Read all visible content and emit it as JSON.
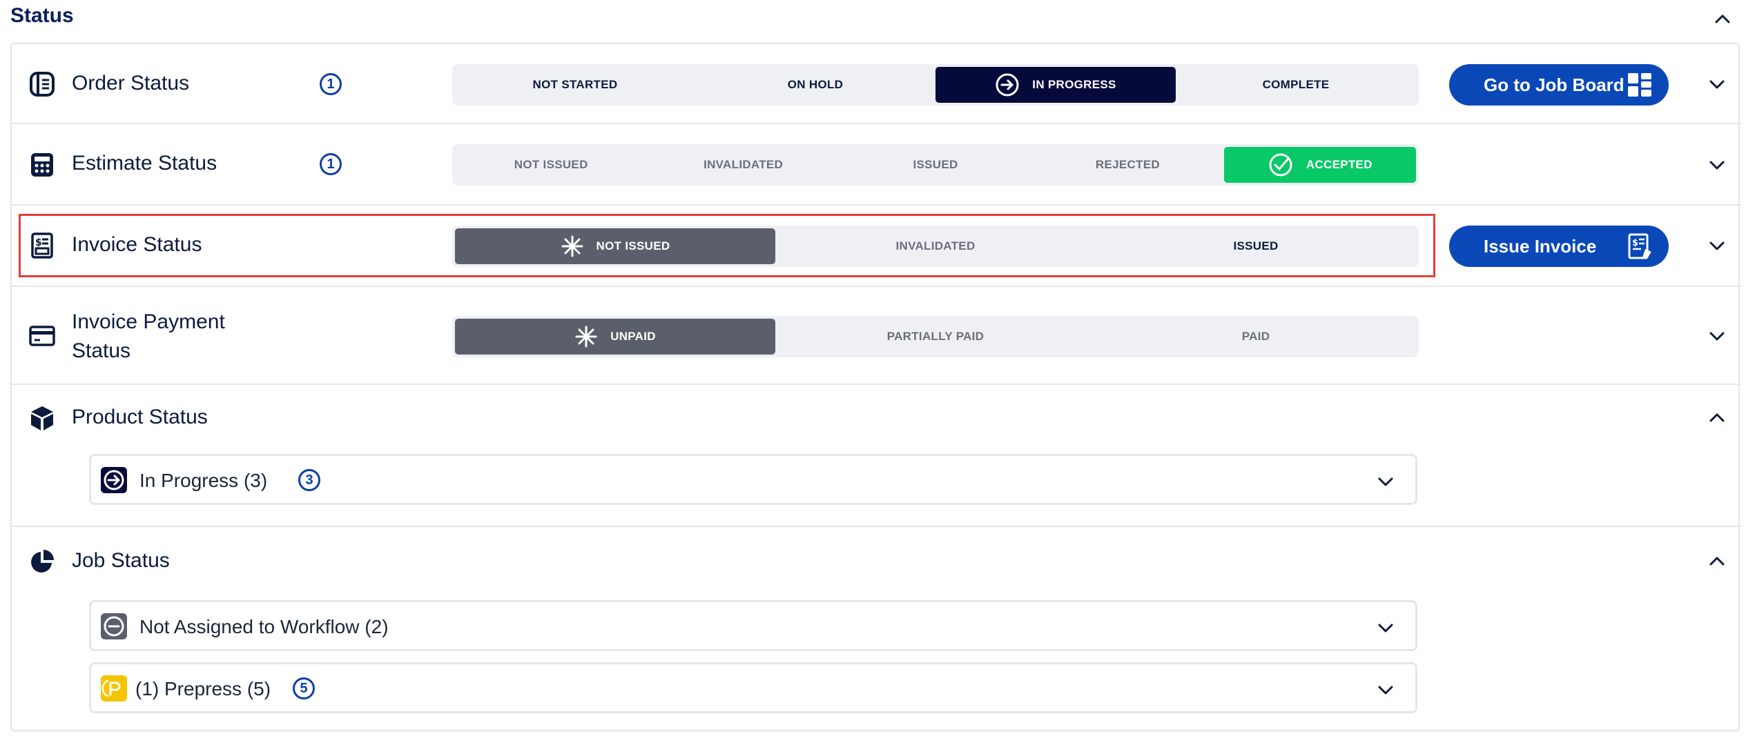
{
  "section": {
    "title": "Status"
  },
  "order_status": {
    "label": "Order Status",
    "badge": "1",
    "options": [
      "NOT STARTED",
      "ON HOLD",
      "IN PROGRESS",
      "COMPLETE"
    ],
    "selected": "IN PROGRESS",
    "action_label": "Go to Job Board"
  },
  "estimate_status": {
    "label": "Estimate Status",
    "badge": "1",
    "options": [
      "NOT ISSUED",
      "INVALIDATED",
      "ISSUED",
      "REJECTED",
      "ACCEPTED"
    ],
    "selected": "ACCEPTED"
  },
  "invoice_status": {
    "label": "Invoice Status",
    "options": [
      "NOT ISSUED",
      "INVALIDATED",
      "ISSUED"
    ],
    "selected": "NOT ISSUED",
    "action_label": "Issue Invoice"
  },
  "invoice_payment_status": {
    "label_line1": "Invoice Payment",
    "label_line2": "Status",
    "options": [
      "UNPAID",
      "PARTIALLY PAID",
      "PAID"
    ],
    "selected": "UNPAID"
  },
  "product_status": {
    "label": "Product Status",
    "items": [
      {
        "label": "In Progress (3)",
        "badge": "3",
        "icon": "arrow-right-circle-icon"
      }
    ]
  },
  "job_status": {
    "label": "Job Status",
    "items": [
      {
        "label": "Not Assigned to Workflow (2)",
        "icon": "minus-circle-icon"
      },
      {
        "label": "(1) Prepress (5)",
        "badge": "5",
        "icon": "prepress-icon"
      }
    ]
  },
  "colors": {
    "navy": "#050a3a",
    "brand_blue": "#0a48b8",
    "accepted_green": "#08c867",
    "selected_grey": "#5b5f6b",
    "highlight_red": "#e0403c",
    "prepress_yellow": "#f5c400"
  }
}
